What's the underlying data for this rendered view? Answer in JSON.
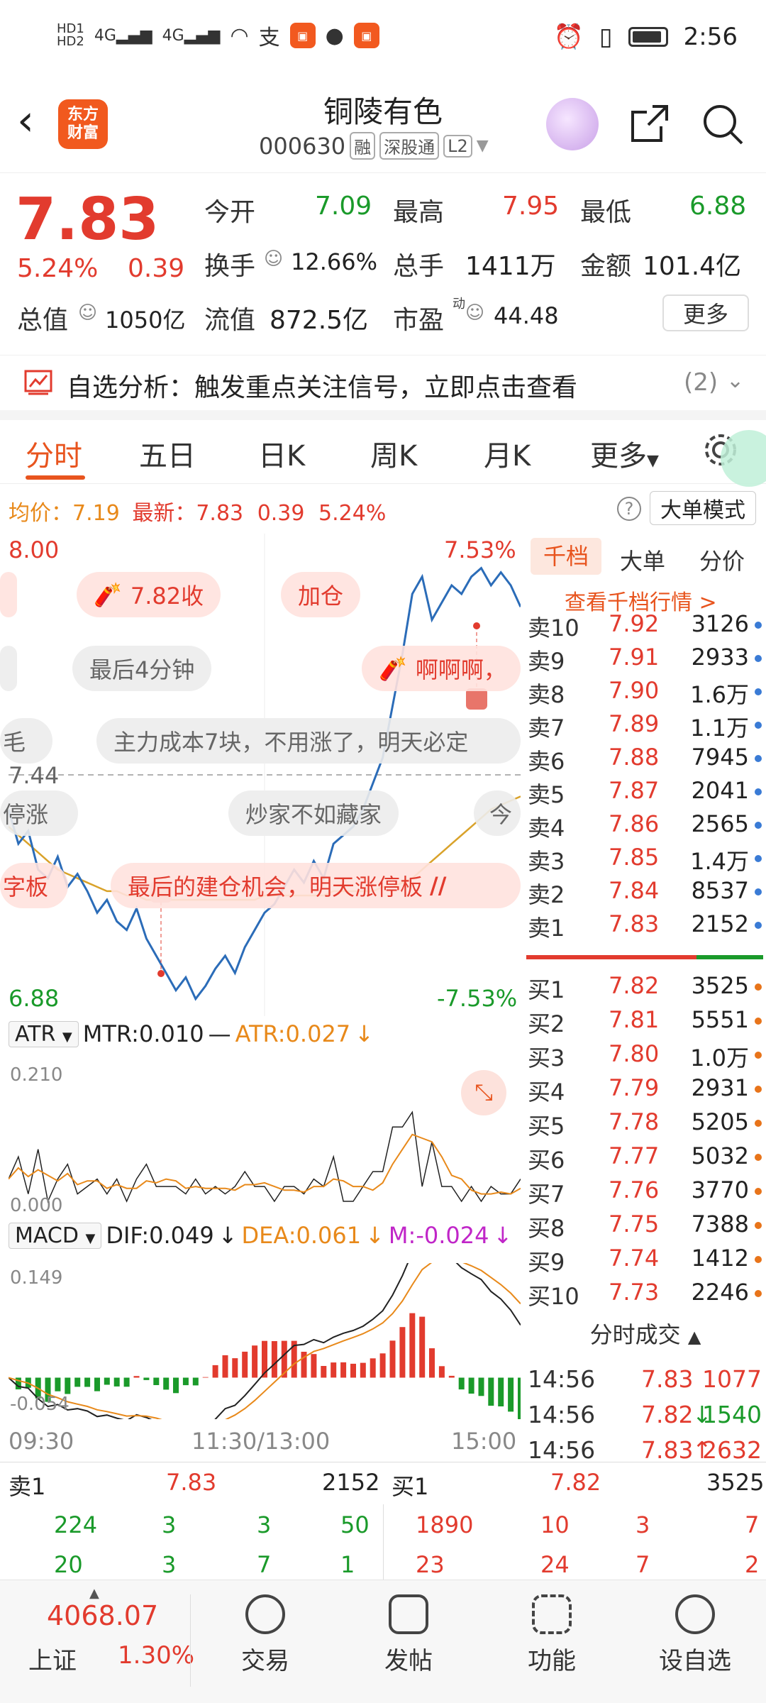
{
  "status_bar": {
    "time": "2:56",
    "left_icons": [
      "HD-signal-icon",
      "4G-signal-icon",
      "4G-signal-icon",
      "wifi-icon",
      "alipay-icon",
      "app-icon",
      "message-icon",
      "app-icon"
    ],
    "right_icons": [
      "alarm-icon",
      "vibrate-icon",
      "battery-icon"
    ]
  },
  "header": {
    "logo_text": "东方\n财富",
    "title": "铜陵有色",
    "code": "000630",
    "tags": [
      "融",
      "深股通",
      "L2"
    ]
  },
  "quote": {
    "price": "7.83",
    "pct": "5.24%",
    "change": "0.39",
    "open_label": "今开",
    "open": "7.09",
    "high_label": "最高",
    "high": "7.95",
    "low_label": "最低",
    "low": "6.88",
    "turnover_label": "换手",
    "turnover": "12.66%",
    "volume_label": "总手",
    "volume": "1411万",
    "amount_label": "金额",
    "amount": "101.4亿",
    "mktcap_label": "总值",
    "mktcap": "1050亿",
    "float_label": "流值",
    "float": "872.5亿",
    "pe_label": "市盈",
    "pe_sup": "动",
    "pe": "44.48",
    "more": "更多"
  },
  "analysis": {
    "text": "自选分析：触发重点关注信号，立即点击查看",
    "count": "(2)"
  },
  "tabs": [
    "分时",
    "五日",
    "日K",
    "周K",
    "月K",
    "更多"
  ],
  "chart_info": {
    "avg_label": "均价：",
    "avg": "7.19",
    "latest_label": "最新：",
    "latest": "7.83",
    "chg": "0.39",
    "pct": "5.24%",
    "big_mode": "大单模式"
  },
  "chart_data": {
    "type": "line",
    "y_top": "8.00",
    "y_bottom": "6.88",
    "pct_top": "7.53%",
    "pct_bottom": "-7.53%",
    "prev_close_label": "7.44",
    "x_labels": [
      "09:30",
      "11:30/13:00",
      "15:00"
    ],
    "series": [
      {
        "values": [
          7.36,
          7.28,
          7.31,
          7.22,
          7.2,
          7.25,
          7.18,
          7.21,
          7.17,
          7.12,
          7.15,
          7.1,
          7.08,
          7.13,
          7.06,
          7.02,
          6.98,
          6.94,
          6.97,
          6.92,
          6.95,
          6.99,
          7.02,
          6.98,
          7.04,
          7.08,
          7.12,
          7.14,
          7.18,
          7.22,
          7.19,
          7.24,
          7.2,
          7.28,
          7.3,
          7.32,
          7.36,
          7.42,
          7.48,
          7.6,
          7.72,
          7.86,
          7.9,
          7.8,
          7.84,
          7.88,
          7.86,
          7.9,
          7.92,
          7.88,
          7.91,
          7.88,
          7.83
        ]
      },
      {
        "values": [
          7.32,
          7.3,
          7.28,
          7.26,
          7.24,
          7.22,
          7.21,
          7.2,
          7.19,
          7.18,
          7.17,
          7.17,
          7.16,
          7.16,
          7.15,
          7.15,
          7.15,
          7.15,
          7.15,
          7.15,
          7.15,
          7.15,
          7.15,
          7.15,
          7.15,
          7.15,
          7.16,
          7.16,
          7.16,
          7.16,
          7.16,
          7.16,
          7.16,
          7.17,
          7.17,
          7.17,
          7.17,
          7.17,
          7.18,
          7.18,
          7.19,
          7.2,
          7.22,
          7.24,
          7.26,
          7.28,
          7.3,
          7.32,
          7.34,
          7.36,
          7.37,
          7.38,
          7.39
        ]
      }
    ]
  },
  "annotations": [
    {
      "text": "7.82收",
      "style": "pink",
      "icon": "firecracker-icon"
    },
    {
      "text": "加仓",
      "style": "pink"
    },
    {
      "text": "最后4分钟",
      "style": "grey"
    },
    {
      "text": "啊啊啊，",
      "style": "pink",
      "icon": "firecracker-icon"
    },
    {
      "text": "毛",
      "style": "grey"
    },
    {
      "text": "主力成本7块，不用涨了，明天必定",
      "style": "grey"
    },
    {
      "text": "停涨",
      "style": "grey"
    },
    {
      "text": "炒家不如藏家",
      "style": "grey"
    },
    {
      "text": "今",
      "style": "grey"
    },
    {
      "text": "字板",
      "style": "pink"
    },
    {
      "text": "最后的建仓机会，明天涨停板",
      "style": "pink"
    }
  ],
  "atr": {
    "name": "ATR",
    "mtr": "MTR:0.010",
    "atr": "ATR:0.027",
    "top": "0.210",
    "bottom": "0.000"
  },
  "macd": {
    "name": "MACD",
    "dif": "DIF:0.049",
    "dea": "DEA:0.061",
    "m": "M:-0.024",
    "top": "0.149",
    "bottom": "-0.054"
  },
  "orderbook": {
    "tabs": [
      "千档",
      "大单",
      "分价"
    ],
    "link": "查看千档行情 >",
    "sells": [
      {
        "label": "卖10",
        "price": "7.92",
        "vol": "3126"
      },
      {
        "label": "卖9",
        "price": "7.91",
        "vol": "2933"
      },
      {
        "label": "卖8",
        "price": "7.90",
        "vol": "1.6万"
      },
      {
        "label": "卖7",
        "price": "7.89",
        "vol": "1.1万"
      },
      {
        "label": "卖6",
        "price": "7.88",
        "vol": "7945"
      },
      {
        "label": "卖5",
        "price": "7.87",
        "vol": "2041"
      },
      {
        "label": "卖4",
        "price": "7.86",
        "vol": "2565"
      },
      {
        "label": "卖3",
        "price": "7.85",
        "vol": "1.4万"
      },
      {
        "label": "卖2",
        "price": "7.84",
        "vol": "8537"
      },
      {
        "label": "卖1",
        "price": "7.83",
        "vol": "2152"
      }
    ],
    "buys": [
      {
        "label": "买1",
        "price": "7.82",
        "vol": "3525"
      },
      {
        "label": "买2",
        "price": "7.81",
        "vol": "5551"
      },
      {
        "label": "买3",
        "price": "7.80",
        "vol": "1.0万"
      },
      {
        "label": "买4",
        "price": "7.79",
        "vol": "2931"
      },
      {
        "label": "买5",
        "price": "7.78",
        "vol": "5205"
      },
      {
        "label": "买6",
        "price": "7.77",
        "vol": "5032"
      },
      {
        "label": "买7",
        "price": "7.76",
        "vol": "3770"
      },
      {
        "label": "买8",
        "price": "7.75",
        "vol": "7388"
      },
      {
        "label": "买9",
        "price": "7.74",
        "vol": "1412"
      },
      {
        "label": "买10",
        "price": "7.73",
        "vol": "2246"
      }
    ]
  },
  "ticks": {
    "title": "分时成交",
    "rows": [
      {
        "time": "14:56",
        "price": "7.83",
        "vol": "1077",
        "arrow": ""
      },
      {
        "time": "14:56",
        "price": "7.82",
        "vol": "1540",
        "arrow": "↓"
      },
      {
        "time": "14:56",
        "price": "7.83",
        "vol": "2632",
        "arrow": "↑"
      }
    ]
  },
  "depth": {
    "sell_label": "卖1",
    "sell_price": "7.83",
    "sell_vol": "2152",
    "buy_label": "买1",
    "buy_price": "7.82",
    "buy_vol": "3525",
    "sell_rows": [
      [
        "224",
        "3",
        "3",
        "50"
      ],
      [
        "20",
        "3",
        "7",
        "1"
      ]
    ],
    "buy_rows": [
      [
        "1890",
        "10",
        "3",
        "7"
      ],
      [
        "23",
        "24",
        "7",
        "2"
      ]
    ]
  },
  "nav": {
    "index_value": "4068.07",
    "index_name": "上证",
    "index_pct": "1.30%",
    "items": [
      "交易",
      "发帖",
      "功能",
      "设自选"
    ]
  }
}
